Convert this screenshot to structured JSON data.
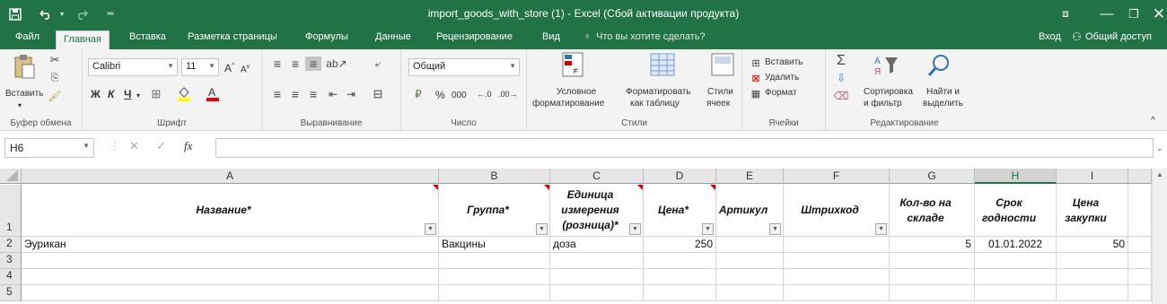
{
  "app": {
    "title": "import_goods_with_store (1) - Excel (Сбой активации продукта)",
    "save_icon": "save-icon",
    "undo_icon": "undo-icon",
    "redo_icon": "redo-icon",
    "accent": "#217346"
  },
  "tabs": [
    "Файл",
    "Главная",
    "Вставка",
    "Разметка страницы",
    "Формулы",
    "Данные",
    "Рецензирование",
    "Вид"
  ],
  "tellme": "Что вы хотите сделать?",
  "signin": "Вход",
  "share": "Общий доступ",
  "ribbon": {
    "paste": "Вставить",
    "font_name": "Calibri",
    "font_size": "11",
    "bold": "Ж",
    "italic": "К",
    "underline": "Ч",
    "number_format": "Общий",
    "percent": "%",
    "thousands": "000",
    "cond_format": [
      "Условное",
      "форматирование"
    ],
    "format_table": [
      "Форматировать",
      "как таблицу"
    ],
    "cell_styles": [
      "Стили",
      "ячеек"
    ],
    "insert": "Вставить",
    "delete": "Удалить",
    "format": "Формат",
    "sort": [
      "Сортировка",
      "и фильтр"
    ],
    "find": [
      "Найти и",
      "выделить"
    ],
    "groups": {
      "clipboard": "Буфер обмена",
      "font": "Шрифт",
      "alignment": "Выравнивание",
      "number": "Число",
      "styles": "Стили",
      "cells": "Ячейки",
      "editing": "Редактирование"
    }
  },
  "formula_bar": {
    "name_box": "H6",
    "fx": "fx",
    "value": ""
  },
  "sheet": {
    "columns": [
      "A",
      "B",
      "C",
      "D",
      "E",
      "F",
      "G",
      "H",
      "I"
    ],
    "selected_column": "H",
    "row_numbers": [
      "1",
      "2",
      "3",
      "4",
      "5"
    ],
    "headers": [
      [
        "Название*"
      ],
      [
        "Группа*"
      ],
      [
        "Единица",
        "измерения",
        "(розница)*"
      ],
      [
        "Цена*"
      ],
      [
        "Артикул"
      ],
      [
        "Штрихкод"
      ],
      [
        "Кол-во на",
        "складе"
      ],
      [
        "Срок",
        "годности"
      ],
      [
        "Цена",
        "закупки"
      ]
    ],
    "rows": [
      [
        "Эурикан",
        "Вакцины",
        "доза",
        "250",
        "",
        "",
        "5",
        "01.01.2022",
        "50"
      ]
    ]
  }
}
